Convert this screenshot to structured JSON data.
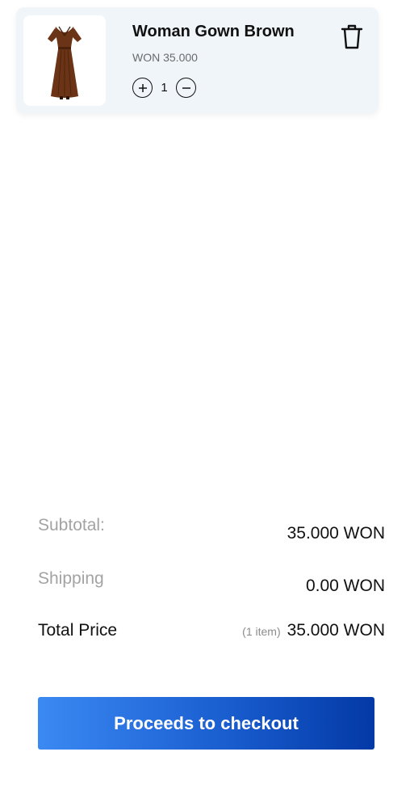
{
  "cart": {
    "items": [
      {
        "title": "Woman Gown Brown",
        "price": "WON 35.000",
        "quantity": "1",
        "image_icon": "brown-gown-image",
        "increment_icon": "plus-circle-icon",
        "decrement_icon": "minus-circle-icon",
        "delete_icon": "trash-icon"
      }
    ]
  },
  "summary": {
    "subtotal_label": "Subtotal:",
    "subtotal_value": "35.000 WON",
    "shipping_label": "Shipping",
    "shipping_value": "0.00 WON",
    "total_label": "Total Price",
    "total_count": "(1 item)",
    "total_value": "35.000 WON"
  },
  "checkout": {
    "label": "Proceeds to checkout"
  },
  "colors": {
    "card_bg": "#f0f5fa",
    "gown": "#6b3416",
    "button_start": "#3b89f3",
    "button_end": "#0339a6"
  }
}
